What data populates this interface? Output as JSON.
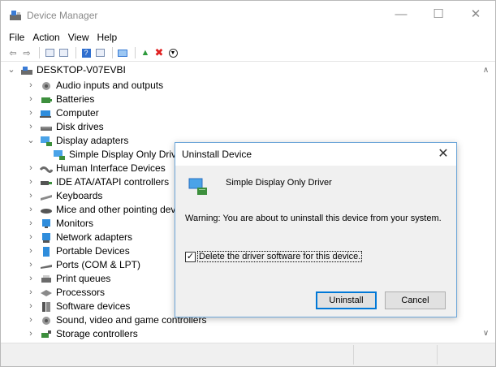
{
  "window": {
    "title": "Device Manager",
    "controls": {
      "minimize": "—",
      "maximize": "☐",
      "close": "✕"
    }
  },
  "menu": [
    "File",
    "Action",
    "View",
    "Help"
  ],
  "toolbar": {
    "icons": [
      "back-arrow-icon",
      "forward-arrow-icon",
      "properties-icon",
      "console-tree-icon",
      "help-icon",
      "computer-list-icon",
      "monitor-icon",
      "update-driver-icon",
      "uninstall-icon",
      "disable-icon"
    ]
  },
  "tree": {
    "root": "DESKTOP-V07EVBI",
    "items": [
      {
        "label": "Audio inputs and outputs",
        "icon": "speaker-icon",
        "expanded": false
      },
      {
        "label": "Batteries",
        "icon": "battery-icon",
        "expanded": false
      },
      {
        "label": "Computer",
        "icon": "computer-icon",
        "expanded": false
      },
      {
        "label": "Disk drives",
        "icon": "disk-icon",
        "expanded": false
      },
      {
        "label": "Display adapters",
        "icon": "display-adapter-icon",
        "expanded": true
      },
      {
        "label": "Simple Display Only Drive",
        "icon": "display-adapter-icon",
        "child": true
      },
      {
        "label": "Human Interface Devices",
        "icon": "hid-icon",
        "expanded": false
      },
      {
        "label": "IDE ATA/ATAPI controllers",
        "icon": "ide-icon",
        "expanded": false
      },
      {
        "label": "Keyboards",
        "icon": "keyboard-icon",
        "expanded": false
      },
      {
        "label": "Mice and other pointing devic",
        "icon": "mouse-icon",
        "expanded": false
      },
      {
        "label": "Monitors",
        "icon": "monitor-icon",
        "expanded": false
      },
      {
        "label": "Network adapters",
        "icon": "network-icon",
        "expanded": false
      },
      {
        "label": "Portable Devices",
        "icon": "portable-device-icon",
        "expanded": false
      },
      {
        "label": "Ports (COM & LPT)",
        "icon": "port-icon",
        "expanded": false
      },
      {
        "label": "Print queues",
        "icon": "printer-icon",
        "expanded": false
      },
      {
        "label": "Processors",
        "icon": "processor-icon",
        "expanded": false
      },
      {
        "label": "Software devices",
        "icon": "software-device-icon",
        "expanded": false
      },
      {
        "label": "Sound, video and game controllers",
        "icon": "speaker-icon",
        "expanded": false
      },
      {
        "label": "Storage controllers",
        "icon": "storage-icon",
        "expanded": false
      }
    ]
  },
  "dialog": {
    "title": "Uninstall Device",
    "device_name": "Simple Display Only Driver",
    "warning": "Warning: You are about to uninstall this device from your system.",
    "checkbox_label": "Delete the driver software for this device.",
    "checkbox_checked": true,
    "uninstall_button": "Uninstall",
    "cancel_button": "Cancel",
    "close_glyph": "✕"
  },
  "colors": {
    "accent": "#0078d7",
    "dialog_border": "#6ea7d9",
    "title_text": "#8a8a8a"
  }
}
